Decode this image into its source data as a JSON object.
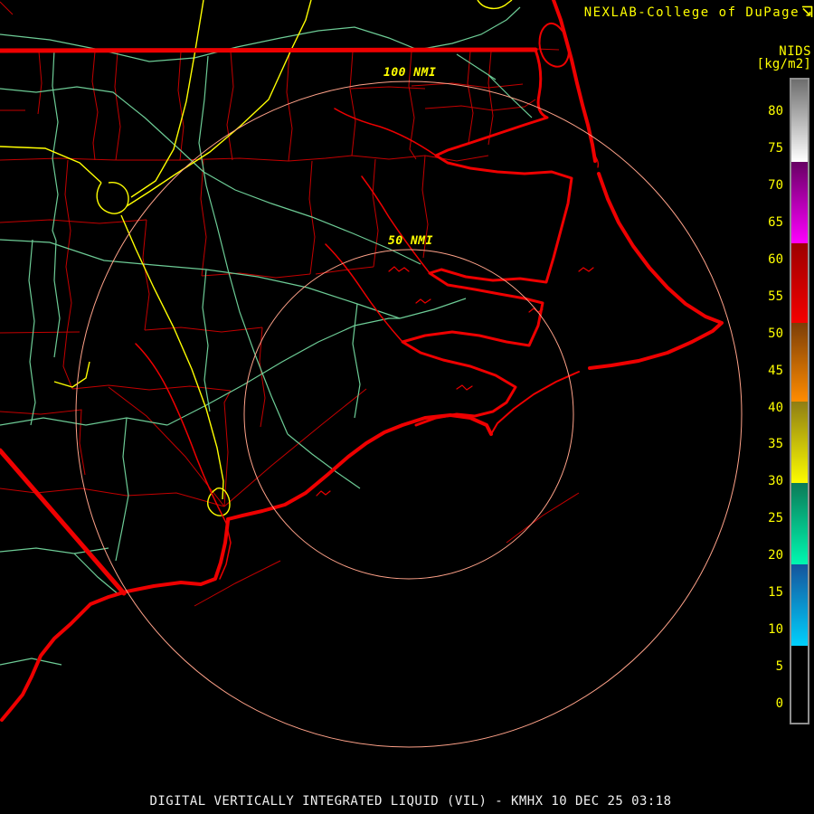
{
  "header": {
    "brand": "NEXLAB-College of DuPage",
    "logo_icon": "flag-glyph"
  },
  "colorbar": {
    "title": "NIDS",
    "units": "[kg/m2]",
    "tick_labels": [
      80,
      75,
      70,
      65,
      60,
      55,
      50,
      45,
      40,
      35,
      30,
      25,
      20,
      15,
      10,
      5,
      0
    ],
    "label_color": "#ffff00",
    "border_color": "#8f8f8f",
    "bands": [
      {
        "from": 7.8,
        "to": 18.8,
        "bottom_color": "#00d0fc",
        "top_color": "#15549c"
      },
      {
        "from": 18.8,
        "to": 29.8,
        "bottom_color": "#00f8b0",
        "top_color": "#0b7a58"
      },
      {
        "from": 29.8,
        "to": 40.8,
        "bottom_color": "#fcfc00",
        "top_color": "#8f7d14"
      },
      {
        "from": 40.8,
        "to": 51.4,
        "bottom_color": "#ff8c00",
        "top_color": "#7c3e08"
      },
      {
        "from": 51.4,
        "to": 62.2,
        "bottom_color": "#f40000",
        "top_color": "#9c0000"
      },
      {
        "from": 62.2,
        "to": 73.2,
        "bottom_color": "#ff00ff",
        "top_color": "#670063"
      },
      {
        "from": 73.2,
        "to": 84.3,
        "bottom_color": "#ffffff",
        "top_color": "#6e6e6e"
      }
    ]
  },
  "map": {
    "range_rings": [
      {
        "label": "50 NMI",
        "radius_nmi": 50
      },
      {
        "label": "100 NMI",
        "radius_nmi": 100
      }
    ],
    "colors": {
      "county_red": "#c40000",
      "road_green": "#6dcc96",
      "road_yellow": "#ffff00",
      "coast_red": "#ee0000",
      "ring_salmon": "#ffa289",
      "label_yellow": "#ffff00"
    }
  },
  "caption": {
    "text": "DIGITAL VERTICALLY INTEGRATED LIQUID (VIL) - KMHX 10 DEC 25 03:18"
  }
}
